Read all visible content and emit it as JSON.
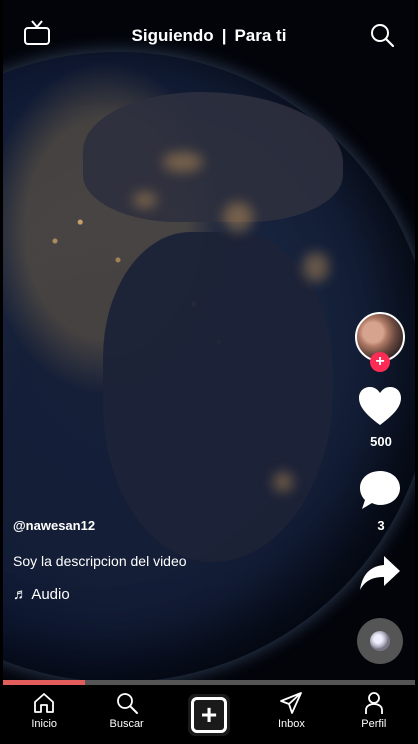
{
  "topbar": {
    "tab_following": "Siguiendo",
    "separator": "|",
    "tab_for_you": "Para ti",
    "left_icon": "tv-icon",
    "right_icon": "search-icon"
  },
  "actions": {
    "avatar_badge": "+",
    "like_icon": "heart-icon",
    "likes": "500",
    "comment_icon": "comment-icon",
    "comments": "3",
    "share_icon": "share-icon",
    "sound_icon": "music-disc-icon"
  },
  "caption": {
    "username": "@nawesan12",
    "description": "Soy la descripcion del video",
    "audio": "♬ Audio"
  },
  "progress": 0.2,
  "nav": {
    "home": "Inicio",
    "search": "Buscar",
    "add": "+",
    "inbox": "Inbox",
    "profile": "Perfil"
  },
  "colors": {
    "accent": "#fe2c55",
    "progress_fill": "#e35d5d",
    "background": "#000000"
  }
}
